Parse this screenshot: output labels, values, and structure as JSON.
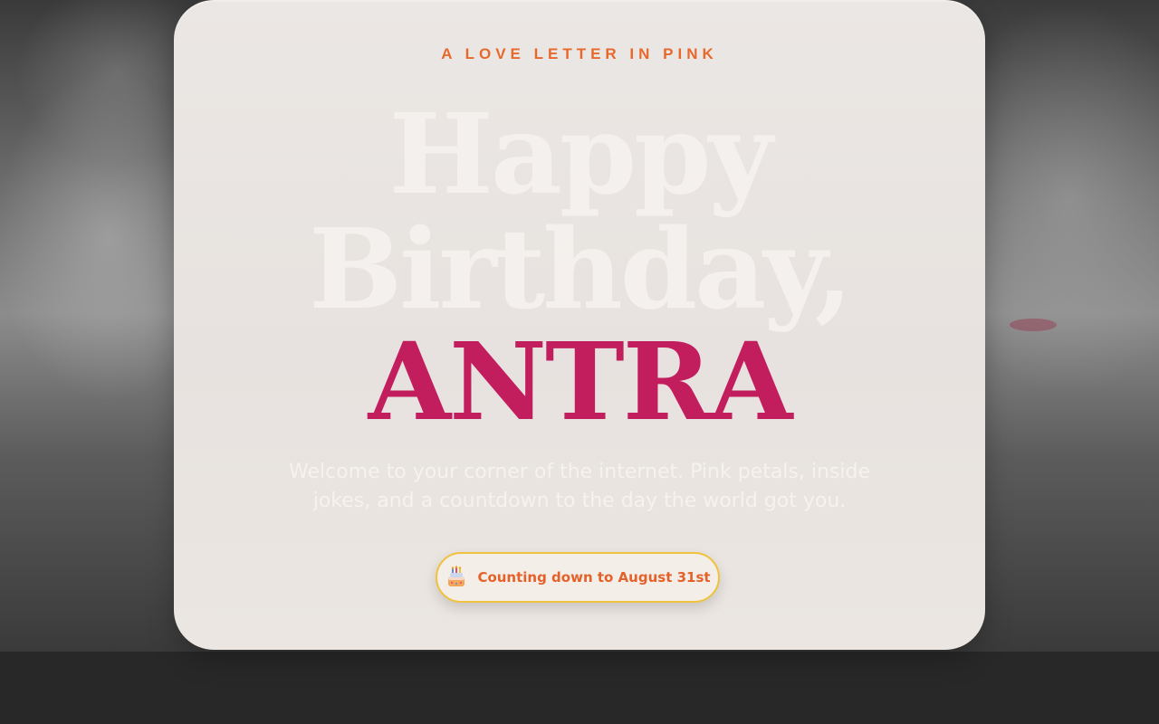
{
  "hero": {
    "eyebrow": "A LOVE LETTER IN PINK",
    "headline_line1": "Happy",
    "headline_line2": "Birthday,",
    "name": "ANTRA",
    "subtitle": "Welcome to your corner of the internet. Pink petals, inside jokes, and a countdown to the day the world got you.",
    "countdown_label": "Counting down to August 31st",
    "countdown_icon": "birthday-cake-icon"
  },
  "colors": {
    "accent_orange": "#e8682c",
    "name_pink": "#c21e5e",
    "badge_border": "#f0c23e",
    "card_bg": "#e9e5e2"
  }
}
